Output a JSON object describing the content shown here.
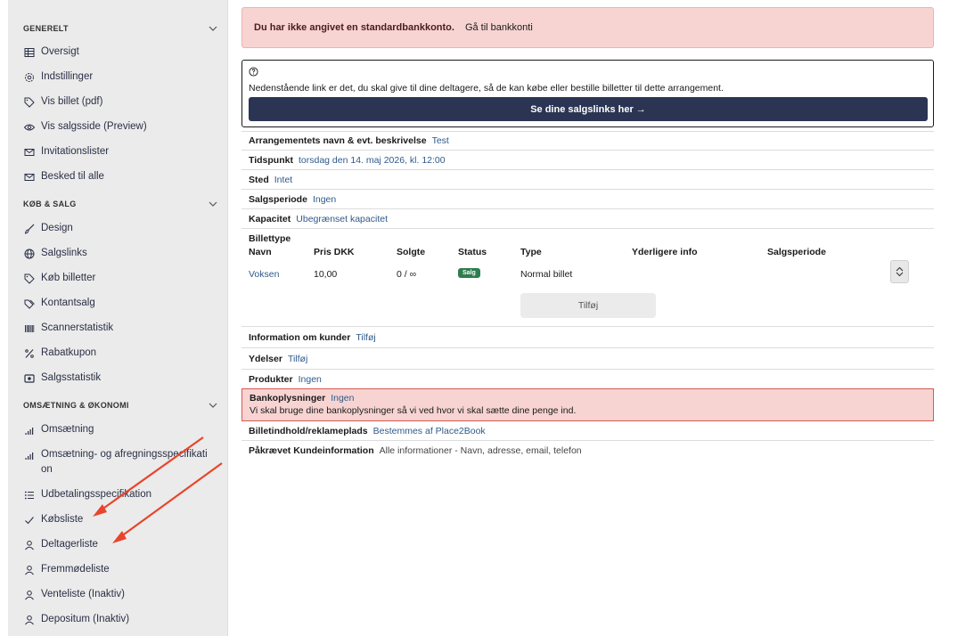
{
  "sidebar": {
    "sections": [
      {
        "title": "GENERELT"
      },
      {
        "title": "KØB & SALG"
      },
      {
        "title": "OMSÆTNING & ØKONOMI"
      }
    ],
    "items": [
      {
        "label": "Oversigt",
        "icon": "table-icon"
      },
      {
        "label": "Indstillinger",
        "icon": "gear-icon"
      },
      {
        "label": "Vis billet (pdf)",
        "icon": "tag-icon"
      },
      {
        "label": "Vis salgsside (Preview)",
        "icon": "eye-icon"
      },
      {
        "label": "Invitationslister",
        "icon": "mail-icon"
      },
      {
        "label": "Besked til alle",
        "icon": "mail-icon"
      },
      {
        "label": "Design",
        "icon": "brush-icon"
      },
      {
        "label": "Salgslinks",
        "icon": "globe-icon"
      },
      {
        "label": "Køb billetter",
        "icon": "tag-icon"
      },
      {
        "label": "Kontantsalg",
        "icon": "tags-icon"
      },
      {
        "label": "Scannerstatistik",
        "icon": "barcode-icon"
      },
      {
        "label": "Rabatkupon",
        "icon": "percent-icon"
      },
      {
        "label": "Salgsstatistik",
        "icon": "stats-icon"
      },
      {
        "label": "Omsætning",
        "icon": "bar-chart-icon"
      },
      {
        "label": "Omsætning- og afregningsspecifikati on",
        "icon": "bar-chart-icon"
      },
      {
        "label": "Udbetalingsspecifikation",
        "icon": "list-icon"
      },
      {
        "label": "Købsliste",
        "icon": "check-icon"
      },
      {
        "label": "Deltagerliste",
        "icon": "user-icon"
      },
      {
        "label": "Fremmødeliste",
        "icon": "user-icon"
      },
      {
        "label": "Venteliste (Inaktiv)",
        "icon": "user-icon"
      },
      {
        "label": "Depositum (Inaktiv)",
        "icon": "user-icon"
      }
    ]
  },
  "alert": {
    "message": "Du har ikke angivet en standardbankkonto.",
    "link": "Gå til bankkonti",
    "color": "#f7d4d2"
  },
  "info": {
    "text": "Nedenstående link er det, du skal give til dine deltagere, så de kan købe eller bestille billetter til dette arrangement.",
    "button": "Se dine salgslinks her →",
    "button_color": "#2b3553"
  },
  "details": {
    "name": {
      "label": "Arrangementets navn & evt. beskrivelse",
      "value": "Test"
    },
    "time": {
      "label": "Tidspunkt",
      "value": "torsdag den 14. maj 2026, kl. 12:00"
    },
    "place": {
      "label": "Sted",
      "value": "Intet"
    },
    "sales_period": {
      "label": "Salgsperiode",
      "value": "Ingen"
    },
    "capacity": {
      "label": "Kapacitet",
      "value": "Ubegrænset kapacitet"
    }
  },
  "tickets": {
    "title": "Billettype",
    "headers": [
      "Navn",
      "Pris DKK",
      "Solgte",
      "Status",
      "Type",
      "Yderligere info",
      "Salgsperiode"
    ],
    "rows": [
      {
        "name": "Voksen",
        "price": "10,00",
        "sold": "0 / ∞",
        "status": "Salg",
        "type": "Normal billet"
      }
    ],
    "add_label": "Tilføj"
  },
  "more": {
    "customers": {
      "label": "Information om kunder",
      "value": "Tilføj"
    },
    "services": {
      "label": "Ydelser",
      "value": "Tilføj"
    },
    "products": {
      "label": "Produkter",
      "value": "Ingen"
    },
    "bank": {
      "label": "Bankoplysninger",
      "value": "Ingen",
      "message": "Vi skal bruge dine bankoplysninger så vi ved hvor vi skal sætte dine penge ind."
    },
    "ticket_content": {
      "label": "Billetindhold/reklameplads",
      "value": "Bestemmes af Place2Book"
    },
    "required_info": {
      "label": "Påkrævet Kundeinformation",
      "value": "Alle informationer - Navn, adresse, email, telefon"
    }
  },
  "annotation": {
    "arrow_color": "#e8452c"
  }
}
